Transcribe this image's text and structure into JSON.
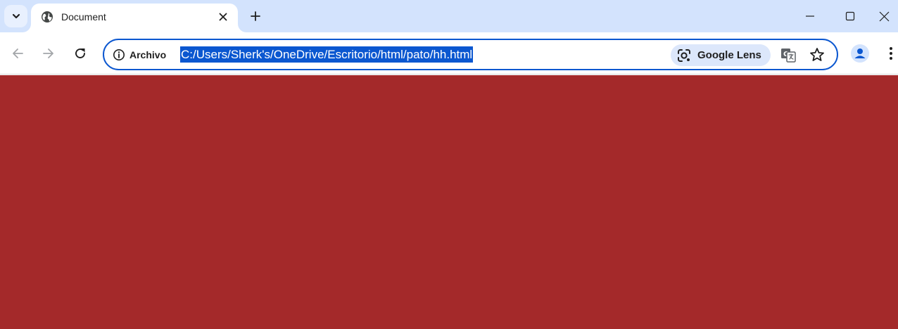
{
  "tab": {
    "title": "Document"
  },
  "omnibox": {
    "chip_label": "Archivo",
    "url": "C:/Users/Sherk's/OneDrive/Escritorio/html/pato/hh.html",
    "lens_label": "Google Lens"
  },
  "page": {
    "background_color": "#a4292a"
  },
  "colors": {
    "tabstrip_bg": "#d3e3fd",
    "accent": "#0b57d0",
    "icon": "#1f1f1f"
  },
  "icons": {
    "tab_search": "chevron-down-icon",
    "favicon": "globe-icon",
    "tab_close": "close-icon",
    "new_tab": "plus-icon",
    "back": "arrow-left-icon",
    "forward": "arrow-right-icon",
    "reload": "reload-icon",
    "site_info": "info-icon",
    "lens": "lens-icon",
    "translate": "translate-icon",
    "bookmark": "star-icon",
    "profile": "person-icon",
    "menu": "kebab-menu-icon"
  }
}
